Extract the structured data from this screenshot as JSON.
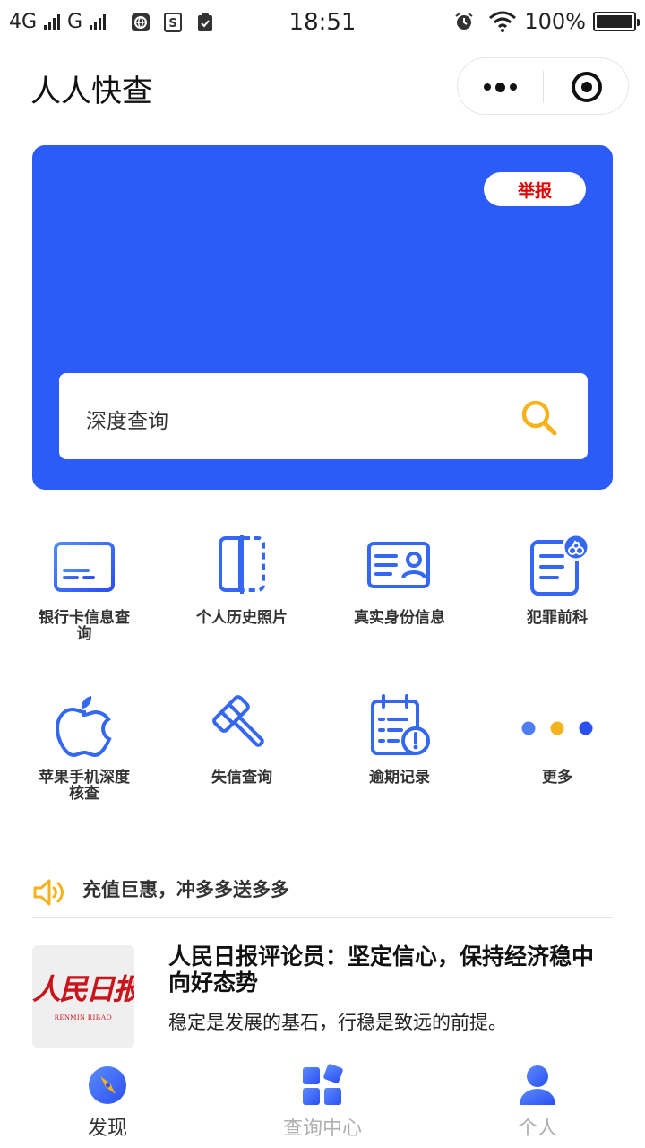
{
  "status_bar": {
    "network1": "4G",
    "network2": "G",
    "time": "18:51",
    "battery": "100%"
  },
  "header": {
    "app_title": "人人快查"
  },
  "banner": {
    "report_label": "举报",
    "search_placeholder": "深度查询",
    "color": "#2b5cf7"
  },
  "grid": {
    "items": [
      {
        "label": "银行卡信息查询",
        "icon": "bank-card-icon"
      },
      {
        "label": "个人历史照片",
        "icon": "photo-frame-icon"
      },
      {
        "label": "真实身份信息",
        "icon": "id-card-icon"
      },
      {
        "label": "犯罪前科",
        "icon": "criminal-record-icon"
      },
      {
        "label": "苹果手机深度核查",
        "icon": "apple-icon"
      },
      {
        "label": "失信查询",
        "icon": "gavel-icon"
      },
      {
        "label": "逾期记录",
        "icon": "overdue-clipboard-icon"
      },
      {
        "label": "更多",
        "icon": "more-dots-icon"
      }
    ]
  },
  "notice": {
    "text": "充值巨惠，冲多多送多多",
    "icon": "speaker-icon"
  },
  "news": {
    "logo_cn": "人民日报",
    "logo_en": "RENMIN RIBAO",
    "title": "人民日报评论员：坚定信心，保持经济稳中向好态势",
    "subtitle": "稳定是发展的基石，行稳是致远的前提。"
  },
  "tabbar": {
    "tabs": [
      {
        "label": "发现",
        "icon": "compass-icon",
        "active": true
      },
      {
        "label": "查询中心",
        "icon": "grid-apps-icon",
        "active": false
      },
      {
        "label": "个人",
        "icon": "user-icon",
        "active": false
      }
    ],
    "active_color": "#333333",
    "inactive_color": "#b0b0b0"
  }
}
